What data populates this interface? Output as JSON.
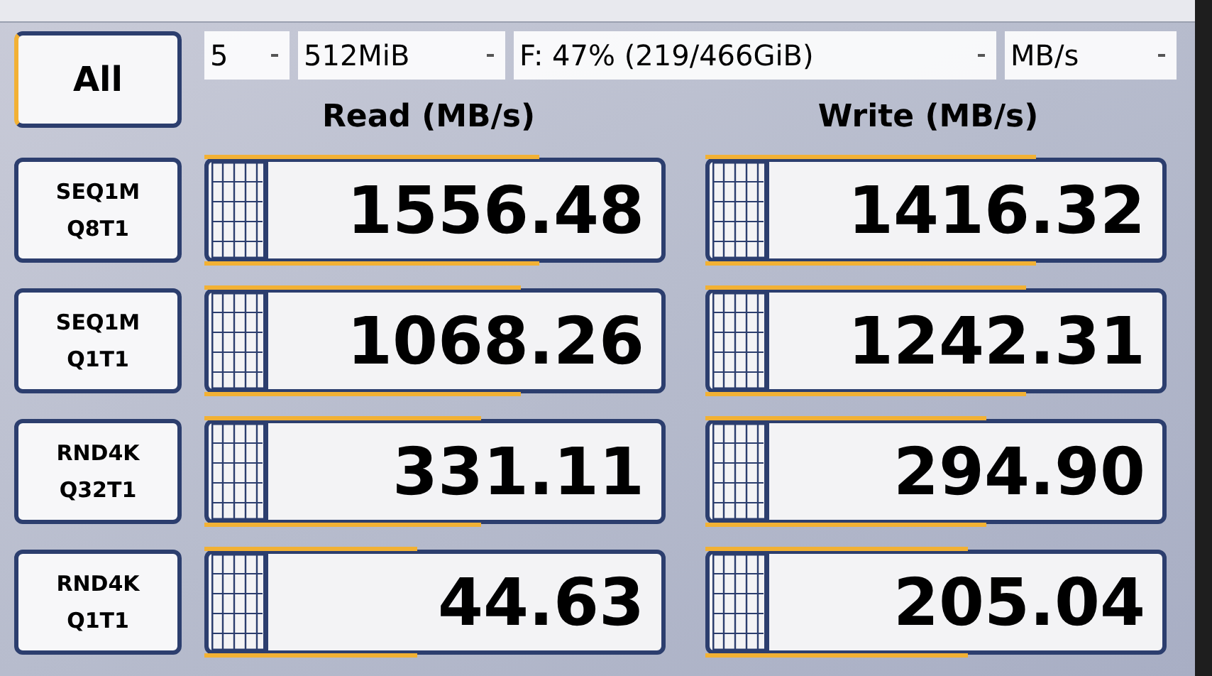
{
  "all_button": {
    "label": "All"
  },
  "selectors": [
    {
      "value": "5"
    },
    {
      "value": "512MiB"
    },
    {
      "value": "F: 47% (219/466GiB)"
    },
    {
      "value": "MB/s"
    }
  ],
  "headers": {
    "read": "Read (MB/s)",
    "write": "Write (MB/s)"
  },
  "tests": [
    {
      "label_line_1": "SEQ1M",
      "label_line_2": "Q8T1",
      "read": {
        "value": "1556.48",
        "level": 0.74
      },
      "write": {
        "value": "1416.32",
        "level": 0.73
      }
    },
    {
      "label_line_1": "SEQ1M",
      "label_line_2": "Q1T1",
      "read": {
        "value": "1068.26",
        "level": 0.7
      },
      "write": {
        "value": "1242.31",
        "level": 0.71
      }
    },
    {
      "label_line_1": "RND4K",
      "label_line_2": "Q32T1",
      "read": {
        "value": "331.11",
        "level": 0.61
      },
      "write": {
        "value": "294.90",
        "level": 0.62
      }
    },
    {
      "label_line_1": "RND4K",
      "label_line_2": "Q1T1",
      "read": {
        "value": "44.63",
        "level": 0.47
      },
      "write": {
        "value": "205.04",
        "level": 0.58
      }
    }
  ]
}
